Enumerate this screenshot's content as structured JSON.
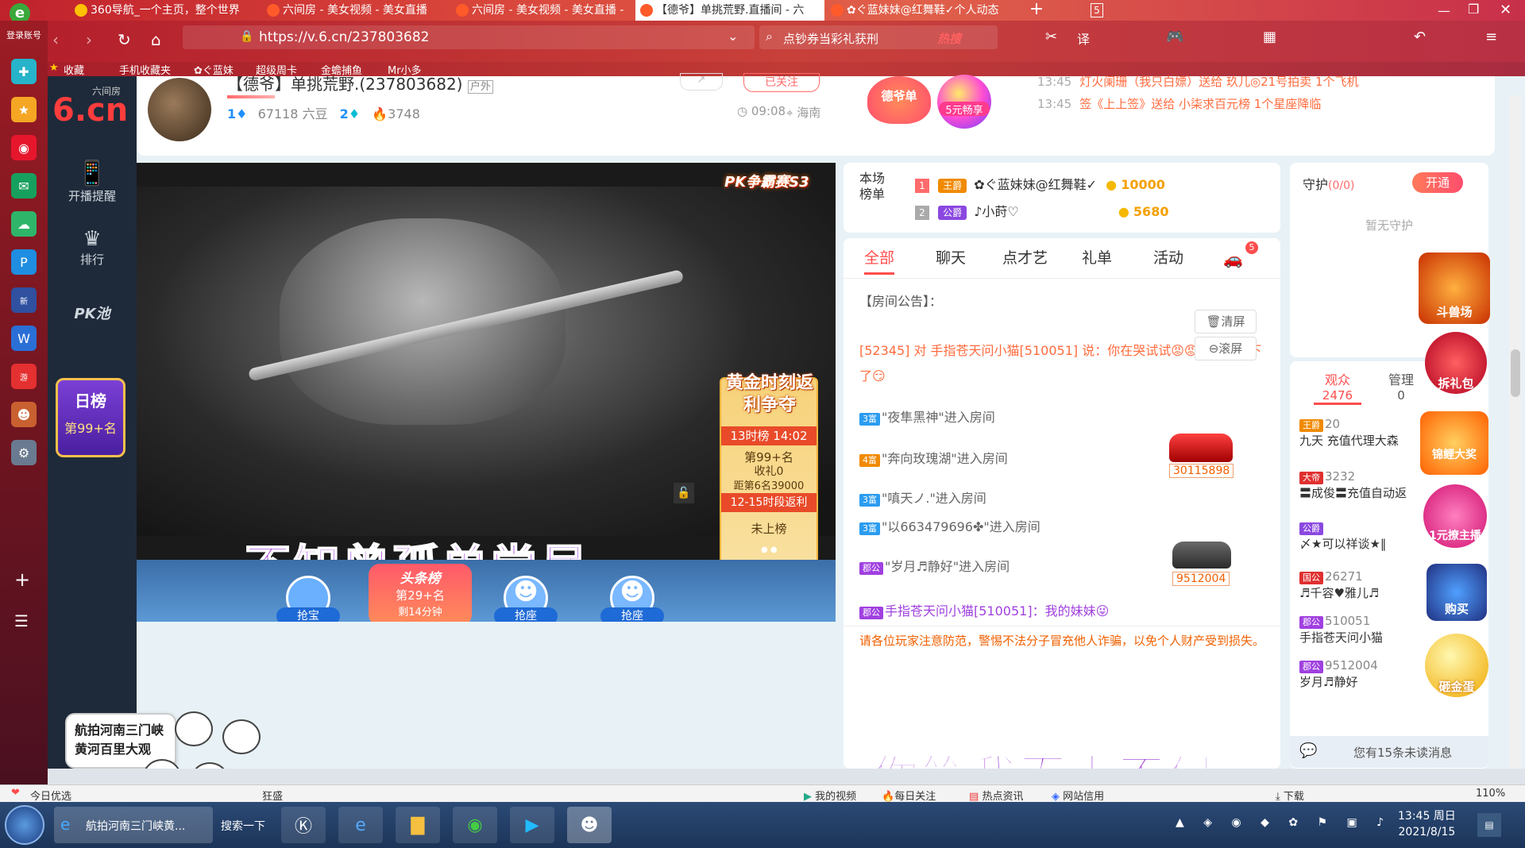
{
  "browser": {
    "tabs": [
      {
        "label": "360导航_一个主页，整个世界"
      },
      {
        "label": "六间房 - 美女视频 - 美女直播"
      },
      {
        "label": "六间房 - 美女视频 - 美女直播 -"
      },
      {
        "label": "【德爷】单挑荒野.直播间 - 六"
      },
      {
        "label": "✿ぐ蓝妹妹@红舞鞋✓个人动态"
      }
    ],
    "tab_count": "5",
    "login_label": "登录账号",
    "url": "https://v.6.cn/237803682",
    "search_placeholder": "点钞券当彩礼获刑",
    "hot_label": "热搜",
    "favorites": [
      "收藏",
      "手机收藏夹",
      "✿ぐ蓝妹",
      "超级周卡",
      "金蟾捕鱼",
      "Mr小多"
    ]
  },
  "site": {
    "logo": "6.cn",
    "logo_small": "六间房",
    "nav": [
      {
        "label": "开播提醒"
      },
      {
        "label": "排行"
      },
      {
        "label": "PK池"
      }
    ],
    "daily_rank": {
      "title": "日榜",
      "rank": "第99+名"
    }
  },
  "header": {
    "room_title": "【德爷】单挑荒野.(237803682)",
    "room_tag": "户外",
    "level1": "1",
    "coins": "67118 六豆",
    "level2": "2",
    "fire": "3748",
    "follow_label": "已关注",
    "time": "09:08",
    "location": "海南",
    "promo1": "德爷单",
    "promo2": "5元畅享",
    "notices": [
      {
        "time": "13:45",
        "text": "灯火阑珊（我只白嫖）送给 玖儿◎21号拍卖 1个飞机"
      },
      {
        "time": "13:45",
        "text": "签《上上签》送给 小柒求百元榜 1个星座降临"
      }
    ]
  },
  "video": {
    "pk_badge": "PK争霸赛S3",
    "event_title": "黄金时刻返利争夺",
    "event_slot": "13时榜 14:02",
    "event_rank": "第99+名",
    "event_gift": "收礼0",
    "event_gap": "距第6名39000",
    "event_range": "12-15时段返利",
    "event_status": "未上榜",
    "lyric_top": "不知曾孤单尝尽",
    "lyric_bottom": "你笑我百毒不侵",
    "seat_label": "抢座",
    "treasure_label": "抢宝",
    "headline_title": "头条榜",
    "headline_rank": "第29+名",
    "headline_sub": "剩14分钟"
  },
  "rank": {
    "title": "本场榜单",
    "rows": [
      {
        "num": "1",
        "title": "王爵",
        "name": "✿ぐ蓝妹妹@红舞鞋✓",
        "value": "10000"
      },
      {
        "num": "2",
        "title": "公爵",
        "name": "♪小莳♡",
        "value": "5680"
      }
    ]
  },
  "chat": {
    "tabs": [
      "全部",
      "聊天",
      "点才艺",
      "礼单",
      "活动"
    ],
    "car_badge": "5",
    "announcement": "【房间公告】：",
    "clear_label": "清屏",
    "scroll_label": "滚屏",
    "messages": [
      {
        "text": "[52345] 对 手指苍天问小猫[510051] 说：你在哭试试😡😡😡老子躺下了😏"
      },
      {
        "badge": "3富",
        "text": "\"夜隼黑神\"进入房间"
      },
      {
        "badge": "4富",
        "text": "\"奔向玫瑰湖\"进入房间",
        "car": "30115898"
      },
      {
        "badge": "3富",
        "text": "\"嗔天ノ.\"进入房间"
      },
      {
        "badge": "3富",
        "text": "\"以663479696✤\"进入房间"
      },
      {
        "badge": "郡公",
        "text": "\"岁月♬静好\"进入房间",
        "car": "9512004"
      },
      {
        "badge": "郡公",
        "text": "手指苍天问小猫[510051]：我的妹妹😜"
      }
    ],
    "warning": "请各位玩家注意防范，警惕不法分子冒充他人诈骗，以免个人财产受到损失。"
  },
  "guard": {
    "title": "守护",
    "count": "(0/0)",
    "open_label": "开通",
    "empty": "暂无守护"
  },
  "audience": {
    "tab1": "观众",
    "tab1_count": "2476",
    "tab2": "管理",
    "tab2_count": "0",
    "users": [
      {
        "title": "王爵",
        "level": "20",
        "name": "九天 充值代理大森"
      },
      {
        "title": "大帝",
        "level": "3232",
        "name": "〓成俊〓充值自动返"
      },
      {
        "title": "公爵",
        "level": "",
        "name": "〆★可以祥谈★‖"
      },
      {
        "title": "国公",
        "level": "26271",
        "name": "♬千容♥雅儿♬"
      },
      {
        "title": "郡公",
        "level": "510051",
        "name": "手指苍天问小猫"
      },
      {
        "title": "郡公",
        "level": "9512004",
        "name": "岁月♬静好"
      }
    ],
    "unread": "您有15条未读消息",
    "side_promos": [
      "斗兽场",
      "拆礼包",
      "锦鲤大奖",
      "1元撩主播",
      "购买",
      "砸金蛋"
    ]
  },
  "overlay": {
    "news_text": "航拍河南三门峡黄河百里大观"
  },
  "statusbar": {
    "left": "今日优选",
    "item2": "狂盛",
    "my_video": "我的视频",
    "daily_follow": "每日关注",
    "hot_news": "热点资讯",
    "credit": "网站信用",
    "download": "下载",
    "zoom": "110%"
  },
  "taskbar": {
    "ie_window": "航拍河南三门峡黄...",
    "search_label": "搜索一下",
    "time": "13:45 周日",
    "date": "2021/8/15"
  }
}
